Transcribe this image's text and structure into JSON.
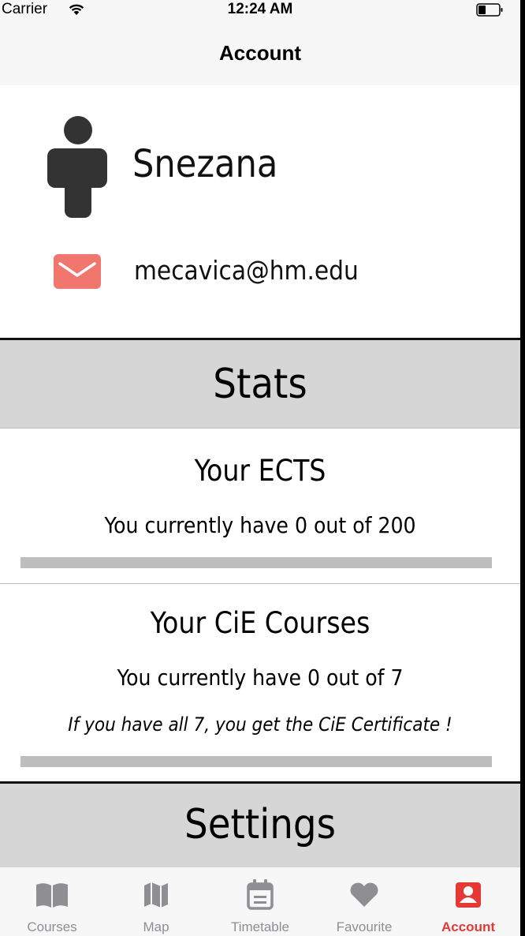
{
  "status_bar": {
    "carrier": "Carrier",
    "time": "12:24 AM",
    "wifi_icon": "wifi-icon",
    "battery_icon": "battery-icon"
  },
  "nav": {
    "title": "Account"
  },
  "profile": {
    "avatar_icon": "person-icon",
    "name": "Snezana",
    "mail_icon": "mail-icon",
    "email": "mecavica@hm.edu"
  },
  "stats": {
    "header": "Stats",
    "ects": {
      "title": "Your ECTS",
      "text": "You currently have 0 out of 200",
      "progress": 0
    },
    "cie": {
      "title": "Your CiE Courses",
      "text": "You currently have 0 out of 7",
      "note": "If you have all 7, you get the CiE Certificate !",
      "progress": 0
    }
  },
  "settings": {
    "header": "Settings"
  },
  "tab_bar": {
    "items": [
      {
        "label": "Courses",
        "icon": "book-icon",
        "active": false
      },
      {
        "label": "Map",
        "icon": "map-icon",
        "active": false
      },
      {
        "label": "Timetable",
        "icon": "calendar-icon",
        "active": false
      },
      {
        "label": "Favourite",
        "icon": "heart-icon",
        "active": false
      },
      {
        "label": "Account",
        "icon": "account-icon",
        "active": true
      }
    ]
  },
  "colors": {
    "accent": "#e53935",
    "inactive_tab": "#8e8e93",
    "section_header_bg": "#d6d6d6",
    "progress_track": "#bdbdbd",
    "mail_icon": "#f0766e",
    "avatar": "#333333"
  }
}
